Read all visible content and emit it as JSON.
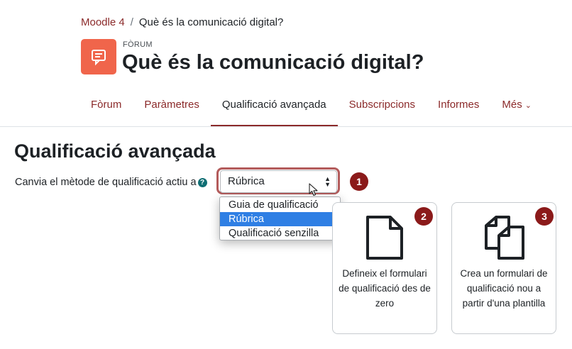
{
  "breadcrumb": {
    "items": [
      {
        "label": "Moodle 4"
      },
      {
        "label": "Què és la comunicació digital?"
      }
    ],
    "separator": "/"
  },
  "header": {
    "activity_type": "FÒRUM",
    "title": "Què és la comunicació digital?",
    "icon": "forum-icon",
    "icon_color": "#f0654b"
  },
  "nav": {
    "items": [
      {
        "label": "Fòrum"
      },
      {
        "label": "Paràmetres"
      },
      {
        "label": "Qualificació avançada",
        "active": true
      },
      {
        "label": "Subscripcions"
      },
      {
        "label": "Informes"
      },
      {
        "label": "Més"
      }
    ],
    "accent": "#8b2a2a"
  },
  "main": {
    "title": "Qualificació avançada",
    "method_label": "Canvia el mètode de qualificació actiu a",
    "help_icon": "?",
    "select": {
      "value": "Rúbrica",
      "options": [
        "Guia de qualificació",
        "Rúbrica",
        "Qualificació senzilla"
      ],
      "selected_index": 1
    },
    "badges": [
      "1",
      "2",
      "3"
    ],
    "cards": [
      {
        "icon": "blank-document-icon",
        "text": "Defineix el formulari de qualificació des de zero"
      },
      {
        "icon": "copy-documents-icon",
        "text": "Crea un formulari de qualificació nou a partir d'una plantilla"
      }
    ]
  }
}
